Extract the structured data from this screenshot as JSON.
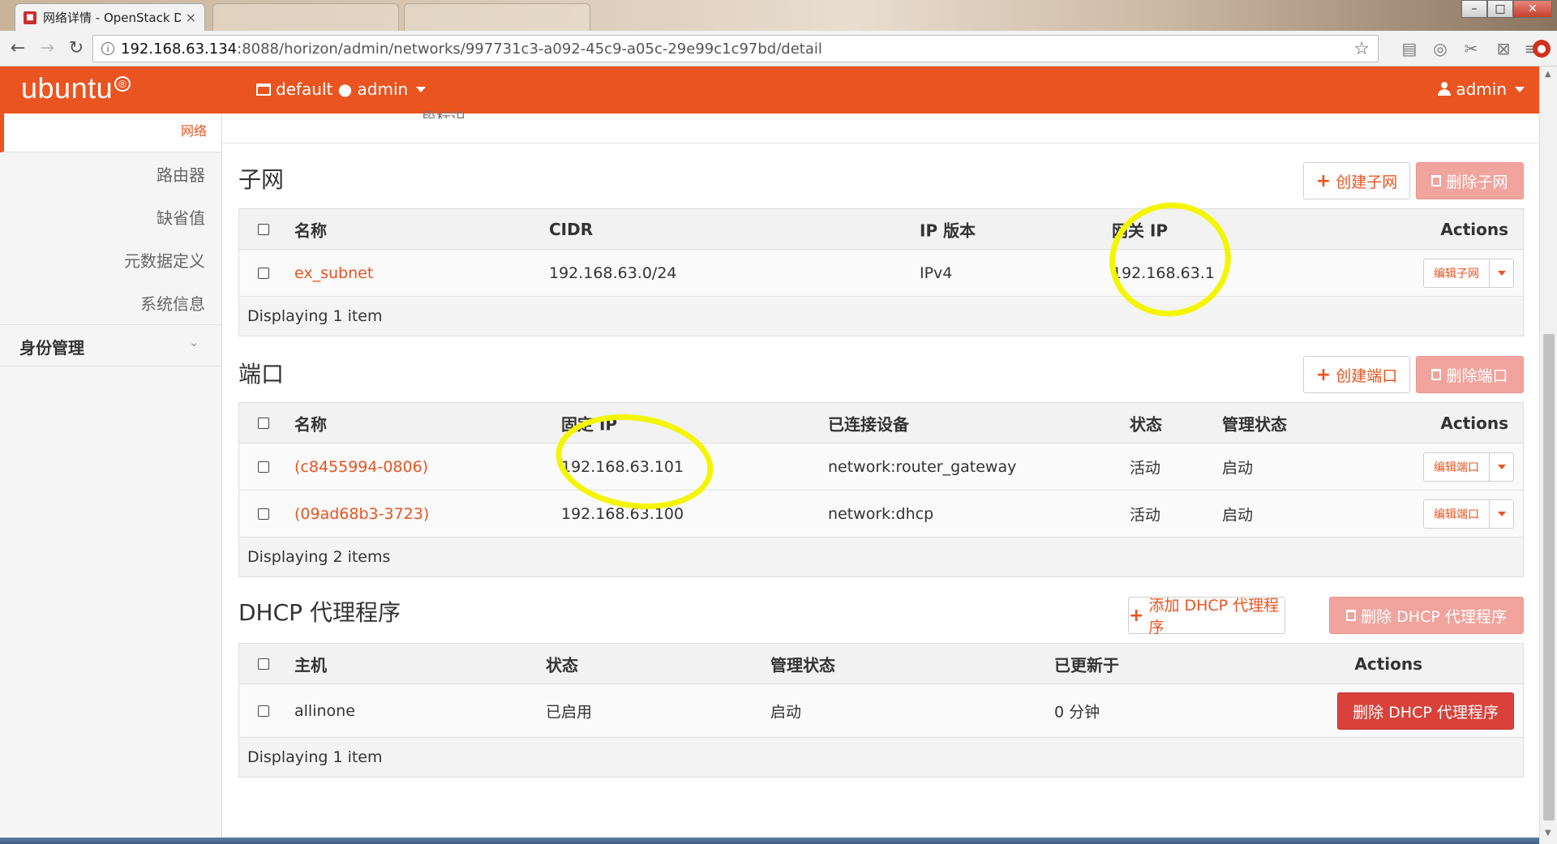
{
  "browser": {
    "active_tab_title": "网络详情 - OpenStack Dashboard",
    "tab_close": "×",
    "url_host": "192.168.63.134",
    "url_rest": ":8088/horizon/admin/networks/997731c3-a092-45c9-a05c-29e99c1c97bd/detail",
    "star": "☆",
    "back": "←",
    "forward": "→",
    "reload": "↻"
  },
  "header": {
    "logo": "ubuntu",
    "logo_mark": "®",
    "project": "default ● admin",
    "user": "admin"
  },
  "sidebar": {
    "items": [
      {
        "label": "网络"
      },
      {
        "label": "路由器"
      },
      {
        "label": "缺省值"
      },
      {
        "label": "元数据定义"
      },
      {
        "label": "系统信息"
      }
    ],
    "section": "身份管理",
    "section_chevron": "⌄"
  },
  "content": {
    "cut_text": "段标识 -",
    "subnets": {
      "title": "子网",
      "create_label": "创建子网",
      "delete_label": "删除子网",
      "headers": [
        "名称",
        "CIDR",
        "IP 版本",
        "网关 IP",
        "Actions"
      ],
      "rows": [
        {
          "name": "ex_subnet",
          "cidr": "192.168.63.0/24",
          "ip_version": "IPv4",
          "gateway": "192.168.63.1",
          "action": "编辑子网"
        }
      ],
      "footer": "Displaying 1 item"
    },
    "ports": {
      "title": "端口",
      "create_label": "创建端口",
      "delete_label": "删除端口",
      "headers": [
        "名称",
        "固定 IP",
        "已连接设备",
        "状态",
        "管理状态",
        "Actions"
      ],
      "rows": [
        {
          "name": "(c8455994-0806)",
          "fixed_ip": "192.168.63.101",
          "device": "network:router_gateway",
          "status": "活动",
          "admin_state": "启动",
          "action": "编辑端口"
        },
        {
          "name": "(09ad68b3-3723)",
          "fixed_ip": "192.168.63.100",
          "device": "network:dhcp",
          "status": "活动",
          "admin_state": "启动",
          "action": "编辑端口"
        }
      ],
      "footer": "Displaying 2 items"
    },
    "dhcp": {
      "title": "DHCP 代理程序",
      "add_label": "添加 DHCP 代理程序",
      "delete_label": "删除 DHCP 代理程序",
      "headers": [
        "主机",
        "状态",
        "管理状态",
        "已更新于",
        "Actions"
      ],
      "rows": [
        {
          "host": "allinone",
          "status": "已启用",
          "admin_state": "启动",
          "updated": "0 分钟",
          "action": "删除 DHCP 代理程序"
        }
      ],
      "footer": "Displaying 1 item"
    }
  },
  "colors": {
    "brand": "#e95420",
    "danger": "#d9413a",
    "highlight": "#f4f600"
  }
}
